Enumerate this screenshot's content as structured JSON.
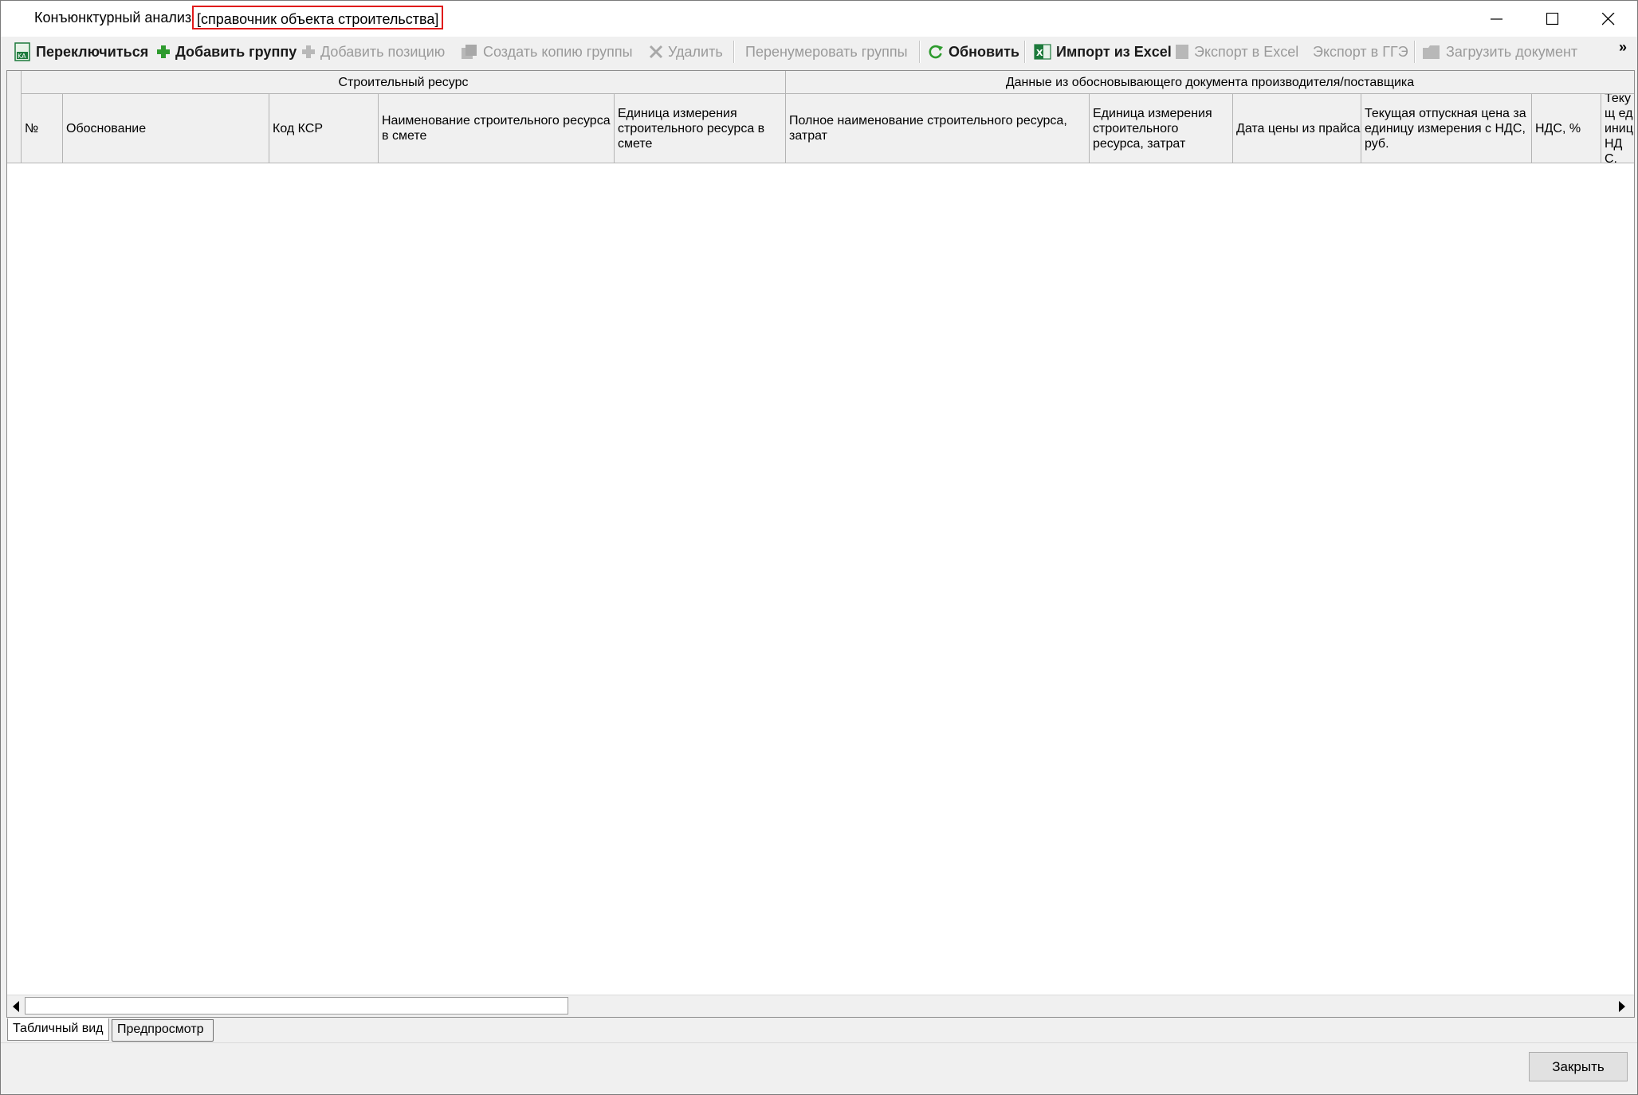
{
  "window": {
    "title": "Конъюнктурный анализ",
    "title_tag": "[справочник объекта строительства]",
    "controls": {
      "minimize": "minimize-icon",
      "maximize": "maximize-icon",
      "close": "close-icon"
    }
  },
  "toolbar": {
    "switch": "Переключиться",
    "add_group": "Добавить группу",
    "add_position": "Добавить позицию",
    "copy_group": "Создать копию группы",
    "delete": "Удалить",
    "renumber": "Перенумеровать группы",
    "refresh": "Обновить",
    "import_excel": "Импорт из Excel",
    "export_excel": "Экспорт в Excel",
    "export_gge": "Экспорт в ГГЭ",
    "load_doc": "Загрузить документ",
    "overflow": "»"
  },
  "table": {
    "bands": {
      "resource": "Строительный ресурс",
      "supplier": "Данные из обосновывающего документа производителя/поставщика"
    },
    "columns": {
      "num": "№",
      "basis": "Обоснование",
      "ksr": "Код КСР",
      "name_in_estimate": "Наименование строительного ресурса в смете",
      "unit_in_estimate": "Единица измерения строительного ресурса в смете",
      "full_name": "Полное наименование строительного ресурса, затрат",
      "unit_cost": "Единица измерения строительного ресурса, затрат",
      "price_date": "Дата цены из прайса",
      "current_price_vat": "Текущая отпускная цена за единицу измерения с НДС, руб.",
      "vat": "НДС, %",
      "next_partial": "Текущ единиц НДС,"
    },
    "rows": []
  },
  "tabs": {
    "table_view": "Табличный вид",
    "preview": "Предпросмотр"
  },
  "footer": {
    "close": "Закрыть"
  },
  "colors": {
    "accent_red": "#e01b1b",
    "green": "#2e9b2e",
    "excel_green": "#1d7a3c"
  }
}
